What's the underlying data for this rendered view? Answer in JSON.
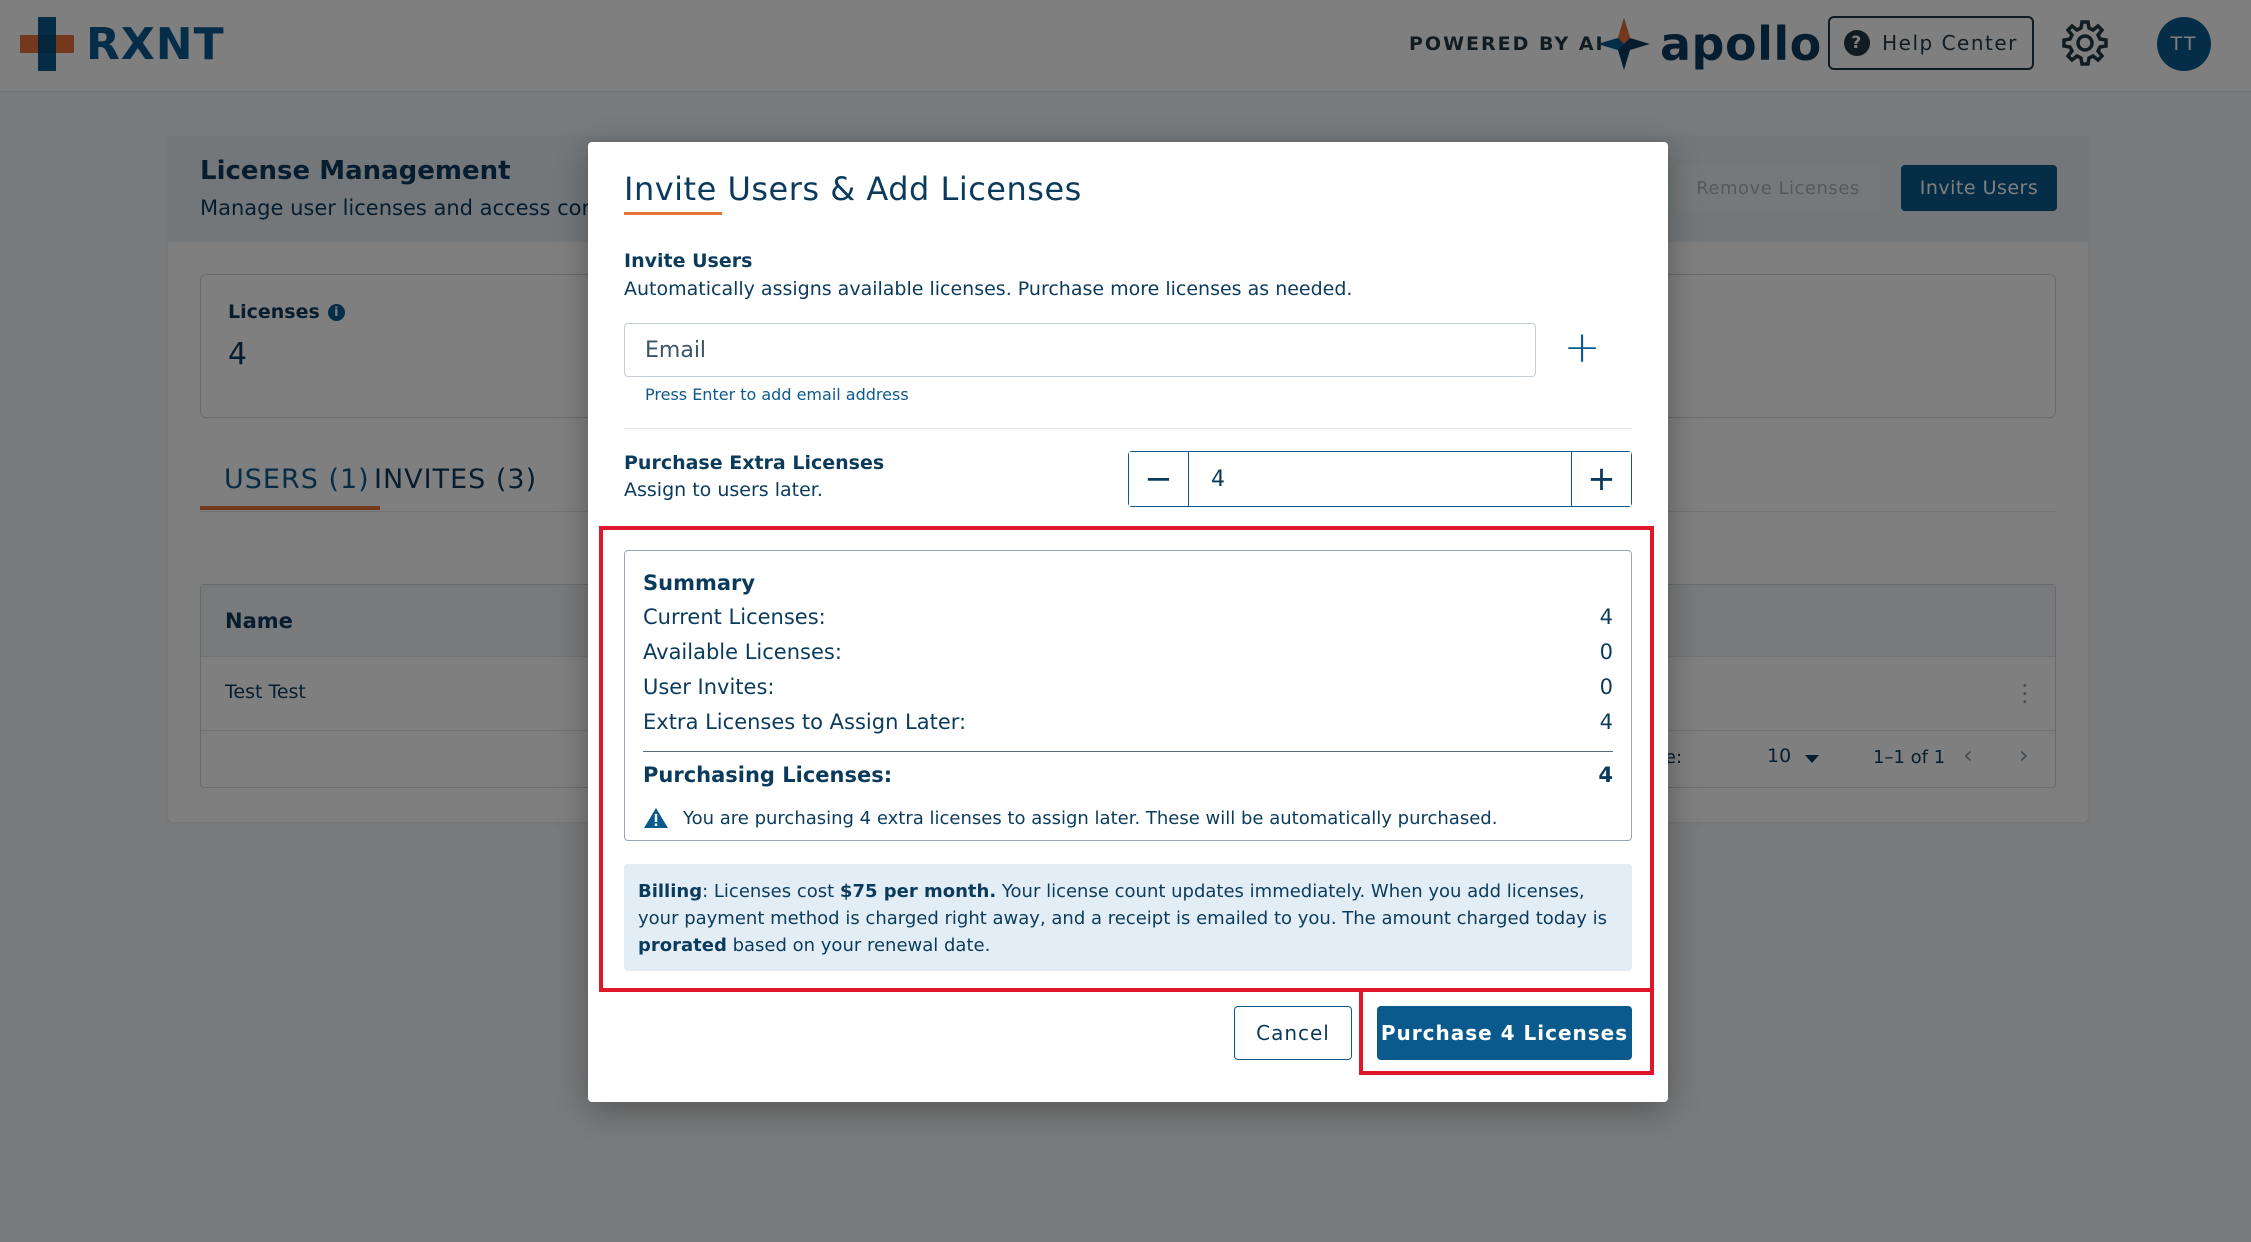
{
  "header": {
    "logo_text": "RXNT",
    "powered_by": "POWERED BY AI",
    "brand": "apollo",
    "help_label": "Help Center",
    "avatar_initials": "TT"
  },
  "page": {
    "title": "License Management",
    "subtitle": "Manage user licenses and access contro",
    "remove_label": "Remove Licenses",
    "invite_label": "Invite Users",
    "licenses_label": "Licenses",
    "licenses_value": "4",
    "tabs": [
      {
        "label": "USERS (1)",
        "active": true
      },
      {
        "label": "INVITES (3)",
        "active": false
      }
    ],
    "table": {
      "header_name": "Name",
      "rows": [
        {
          "name": "Test Test"
        }
      ],
      "rows_per_page_label": "page:",
      "rows_per_page_value": "10",
      "range_text": "1–1 of 1"
    }
  },
  "modal": {
    "title": "Invite Users & Add Licenses",
    "invite_heading": "Invite Users",
    "invite_description": "Automatically assigns available licenses. Purchase more licenses as needed.",
    "email_placeholder": "Email",
    "email_helper": "Press Enter to add email address",
    "extra_heading": "Purchase Extra Licenses",
    "extra_description": "Assign to users later.",
    "extra_value": "4",
    "summary": {
      "title": "Summary",
      "rows": [
        {
          "label": "Current Licenses:",
          "value": "4"
        },
        {
          "label": "Available Licenses:",
          "value": "0"
        },
        {
          "label": "User Invites:",
          "value": "0"
        },
        {
          "label": "Extra Licenses to Assign Later:",
          "value": "4"
        }
      ],
      "total_label": "Purchasing Licenses:",
      "total_value": "4",
      "warning": "You are purchasing 4 extra licenses to assign later. These will be automatically purchased."
    },
    "billing": {
      "label": "Billing",
      "text_1": ": Licenses cost ",
      "price": "$75 per month.",
      "text_2": " Your license count updates immediately. When you add licenses, your payment method is charged right away, and a receipt is emailed to you. The amount charged today is ",
      "prorated": "prorated",
      "text_3": " based on your renewal date."
    },
    "cancel_label": "Cancel",
    "purchase_label": "Purchase 4 Licenses"
  },
  "colors": {
    "brand_blue": "#0b5a8e",
    "brand_orange": "#e8733a",
    "highlight_red": "#e0162b"
  }
}
